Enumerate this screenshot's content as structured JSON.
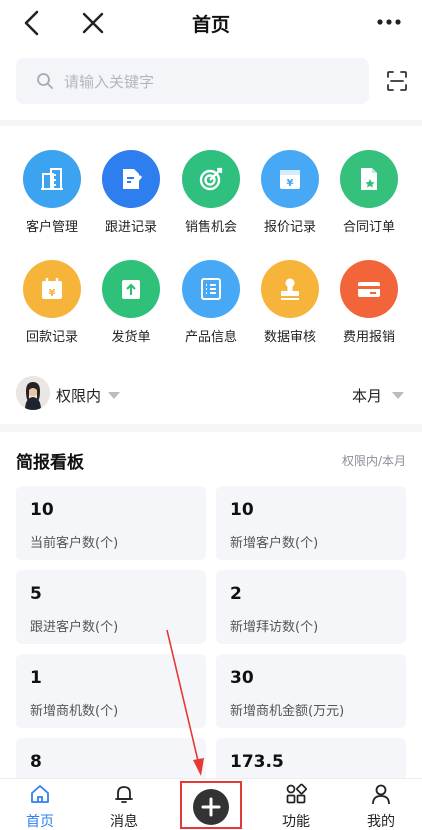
{
  "header": {
    "title": "首页"
  },
  "search": {
    "placeholder": "请输入关键字"
  },
  "quick_actions": [
    {
      "label": "客户管理",
      "icon": "building-icon",
      "color": "#3ba3f0"
    },
    {
      "label": "跟进记录",
      "icon": "edit-note-icon",
      "color": "#2e7ef0"
    },
    {
      "label": "销售机会",
      "icon": "target-icon",
      "color": "#2fbf7f"
    },
    {
      "label": "报价记录",
      "icon": "quote-yen-icon",
      "color": "#47a8f5"
    },
    {
      "label": "合同订单",
      "icon": "contract-star-icon",
      "color": "#35c07c"
    },
    {
      "label": "回款记录",
      "icon": "calendar-yen-icon",
      "color": "#f6b43b"
    },
    {
      "label": "发货单",
      "icon": "box-upload-icon",
      "color": "#2fc07a"
    },
    {
      "label": "产品信息",
      "icon": "list-icon",
      "color": "#47a8f5"
    },
    {
      "label": "数据审核",
      "icon": "stamp-icon",
      "color": "#f6b43b"
    },
    {
      "label": "费用报销",
      "icon": "card-icon",
      "color": "#f2643a"
    }
  ],
  "filter": {
    "scope": "权限内",
    "period": "本月"
  },
  "board": {
    "title": "简报看板",
    "subtitle": "权限内/本月",
    "cards": [
      {
        "value": "10",
        "label": "当前客户数(个)"
      },
      {
        "value": "10",
        "label": "新增客户数(个)"
      },
      {
        "value": "5",
        "label": "跟进客户数(个)"
      },
      {
        "value": "2",
        "label": "新增拜访数(个)"
      },
      {
        "value": "1",
        "label": "新增商机数(个)"
      },
      {
        "value": "30",
        "label": "新增商机金额(万元)"
      },
      {
        "value": "8",
        "label": ""
      },
      {
        "value": "173.5",
        "label": ""
      }
    ]
  },
  "tabbar": [
    {
      "label": "首页",
      "icon": "home-icon"
    },
    {
      "label": "消息",
      "icon": "bell-icon"
    },
    {
      "label": "",
      "icon": "add-icon"
    },
    {
      "label": "功能",
      "icon": "apps-icon"
    },
    {
      "label": "我的",
      "icon": "user-icon"
    }
  ],
  "colors": {
    "accent": "#2f80ed",
    "annotation": "#e53935"
  }
}
